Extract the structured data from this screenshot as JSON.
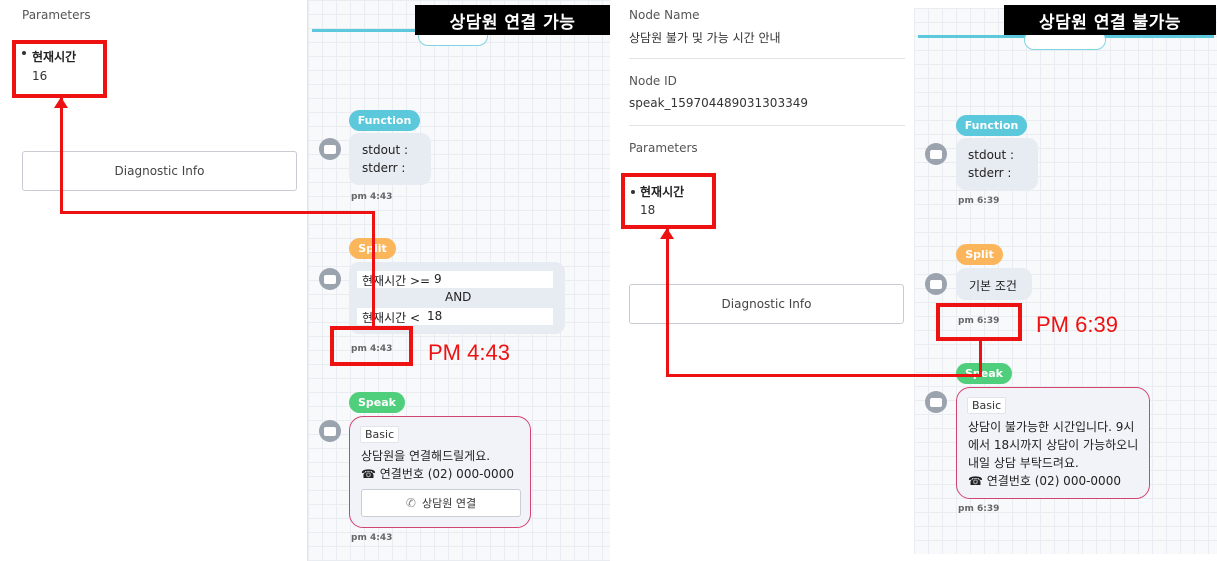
{
  "left_screen": {
    "banner": "상담원 연결 가능",
    "parameters_label": "Parameters",
    "param_name": "현재시간",
    "param_value": "16",
    "diagnostic_label": "Diagnostic Info",
    "function_pill": "Function",
    "stdout": "stdout :",
    "stderr": "stderr :",
    "ts1": "pm 4:43",
    "split_pill": "Split",
    "cond1_var": "현재시간 >=",
    "cond1_val": "9",
    "and_label": "AND",
    "cond2_var": "현재시간 <",
    "cond2_val": "18",
    "ts2": "pm 4:43",
    "speak_pill": "Speak",
    "basic_tag": "Basic",
    "speak_line1": "상담원을 연결해드릴게요.",
    "speak_line2": "☎ 연결번호 (02) 000-0000",
    "call_button": "상담원 연결",
    "ts3": "pm 4:43",
    "annotation": "PM 4:43"
  },
  "right_screen": {
    "banner": "상담원 연결 불가능",
    "node_name_label": "Node Name",
    "node_name_value": "상담원 불가 및 가능 시간 안내",
    "node_id_label": "Node ID",
    "node_id_value": "speak_159704489031303349",
    "parameters_label": "Parameters",
    "param_name": "현재시간",
    "param_value": "18",
    "diagnostic_label": "Diagnostic Info",
    "function_pill": "Function",
    "stdout": "stdout :",
    "stderr": "stderr :",
    "ts1": "pm 6:39",
    "split_pill": "Split",
    "split_result": "기본 조건",
    "ts2": "pm 6:39",
    "speak_pill": "Speak",
    "basic_tag": "Basic",
    "speak_line1": "상담이 불가능한 시간입니다. 9시",
    "speak_line2": "에서 18시까지 상담이 가능하오니",
    "speak_line3": "내일 상담 부탁드려요.",
    "speak_line4": "☎ 연결번호 (02) 000-0000",
    "ts3": "pm 6:39",
    "annotation": "PM 6:39"
  },
  "colors": {
    "highlight": "#ee1111",
    "function": "#5bc8dc",
    "split": "#fbb65c",
    "speak": "#4fce7c",
    "speak_border": "#d2456f"
  }
}
